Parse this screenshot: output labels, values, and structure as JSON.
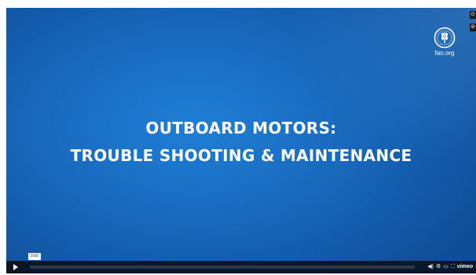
{
  "video": {
    "title_line1": "OUTBOARD MOTORS:",
    "title_line2": "TROUBLE SHOOTING & MAINTENANCE",
    "logo_text": "fao.org",
    "background_color": "#1a6fc4"
  },
  "side_buttons": [
    "⊙",
    "⊘"
  ],
  "player": {
    "time_tooltip": "0:00",
    "progress_fraction": 0.0,
    "accent_color": "#00adef",
    "icons": [
      "volume-icon",
      "settings-icon",
      "pip-icon",
      "fullscreen-icon"
    ],
    "brand": "vimeo"
  }
}
